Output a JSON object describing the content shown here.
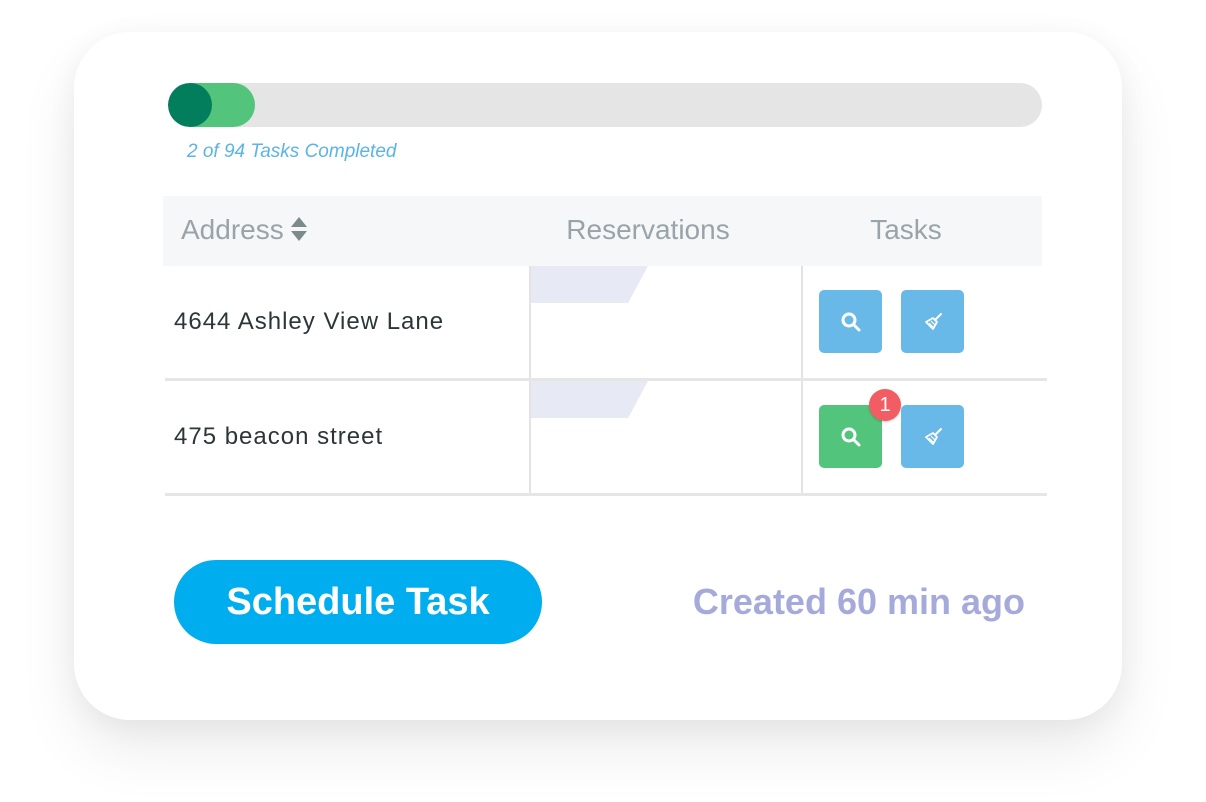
{
  "progress": {
    "completed": 2,
    "total": 94,
    "label": "2 of 94 Tasks Completed",
    "colors": {
      "track": "#e5e5e5",
      "fill": "#52c47c",
      "knob": "#037e5c",
      "label": "#5ab4e6"
    }
  },
  "table": {
    "headers": {
      "address": "Address",
      "address_sort_icon": "sort-up-down-icon",
      "reservations": "Reservations",
      "tasks": "Tasks"
    },
    "rows": [
      {
        "address": "4644 Ashley View Lane",
        "tasks": [
          {
            "icon": "search-icon",
            "type": "inspection",
            "color": "#68b9e8",
            "badge": null
          },
          {
            "icon": "broom-icon",
            "type": "cleaning",
            "color": "#68b9e8",
            "badge": null
          }
        ]
      },
      {
        "address": "475 beacon street",
        "tasks": [
          {
            "icon": "search-icon",
            "type": "inspection",
            "color": "#52c47c",
            "badge": "1"
          },
          {
            "icon": "broom-icon",
            "type": "cleaning",
            "color": "#68b9e8",
            "badge": null
          }
        ]
      }
    ]
  },
  "footer": {
    "schedule_button": "Schedule Task",
    "created": "Created 60 min ago",
    "colors": {
      "button": "#00adee",
      "created": "#a6aadb"
    }
  }
}
